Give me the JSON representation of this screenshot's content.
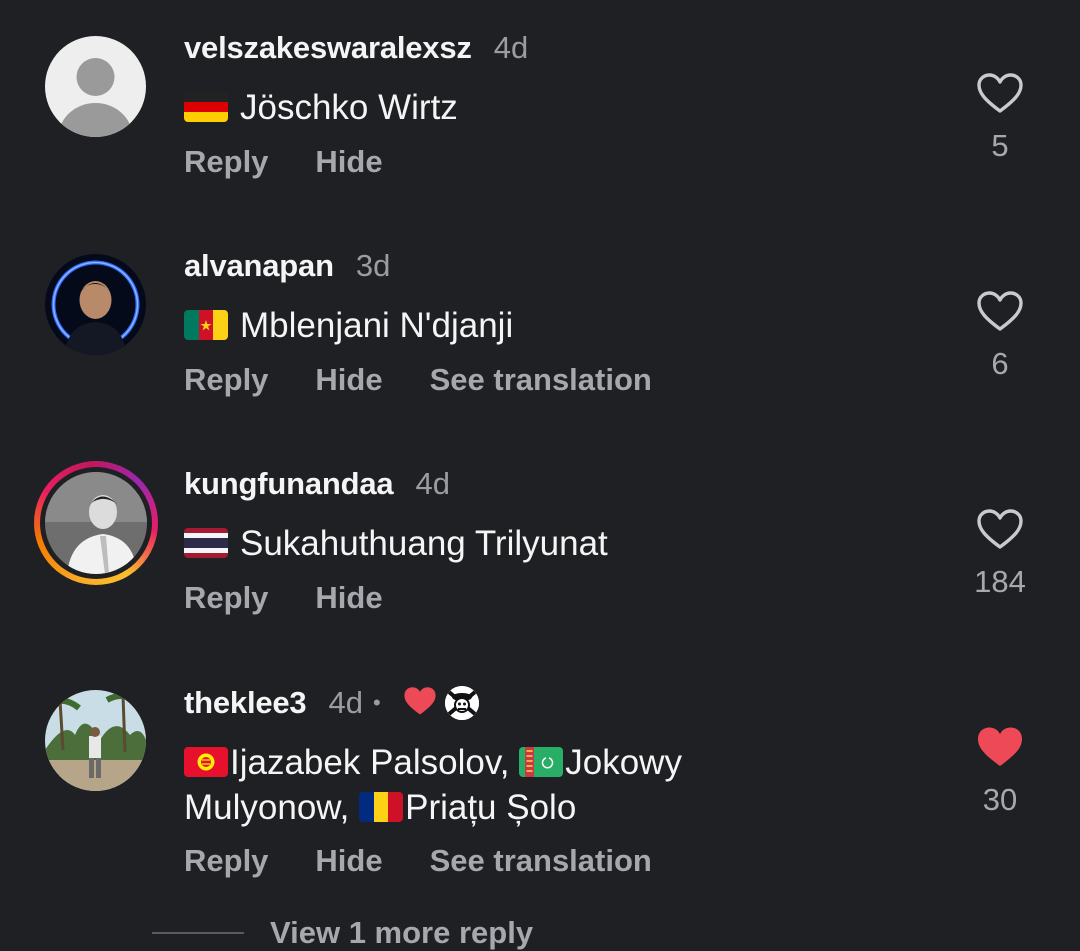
{
  "comments": [
    {
      "username": "velszakeswaralexsz",
      "time": "4d",
      "text": "Jöschko Wirtz",
      "flag": "germany-flag",
      "actions": [
        "Reply",
        "Hide"
      ],
      "likes": "5",
      "liked": false
    },
    {
      "username": "alvanapan",
      "time": "3d",
      "text": "Mblenjani N'djanji",
      "flag": "cameroon-flag",
      "actions": [
        "Reply",
        "Hide",
        "See translation"
      ],
      "likes": "6",
      "liked": false
    },
    {
      "username": "kungfunandaa",
      "time": "4d",
      "text": "Sukahuthuang Trilyunat",
      "flag": "thailand-flag",
      "actions": [
        "Reply",
        "Hide"
      ],
      "likes": "184",
      "liked": false
    },
    {
      "username": "theklee3",
      "time": "4d",
      "dot": "•",
      "parts": [
        {
          "flag": "kyrgyzstan-flag",
          "text": "Ijazabek Palsolov, "
        },
        {
          "flag": "turkmenistan-flag",
          "text": "Jokowy Mulyonow, "
        },
        {
          "flag": "romania-flag",
          "text": "Priațu Șolo"
        }
      ],
      "actions": [
        "Reply",
        "Hide",
        "See translation"
      ],
      "likes": "30",
      "liked": true,
      "liked_by_creator": true
    }
  ],
  "view_more": "View 1 more reply",
  "colors": {
    "background": "#1f2024",
    "text": "#f5f5f5",
    "muted": "#a7a8ad",
    "like_red": "#ed4956"
  }
}
